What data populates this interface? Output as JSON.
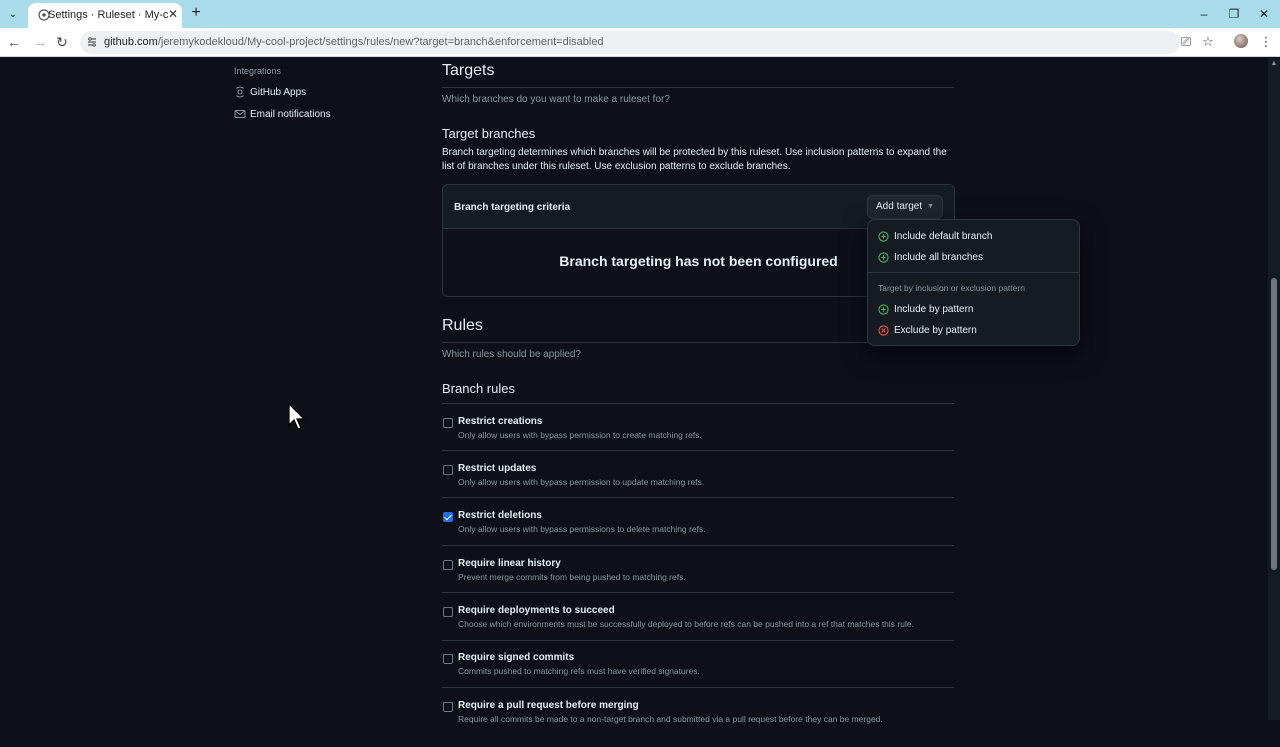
{
  "browser": {
    "tab_title": "Settings · Ruleset · My-cool-pro",
    "url_host": "github.com",
    "url_path": "/jeremykodekloud/My-cool-project/settings/rules/new?target=branch&enforcement=disabled"
  },
  "sidebar": {
    "heading": "Integrations",
    "items": [
      {
        "label": "GitHub Apps",
        "icon": "apps-icon"
      },
      {
        "label": "Email notifications",
        "icon": "mail-icon"
      }
    ]
  },
  "targets": {
    "title": "Targets",
    "subtitle": "Which branches do you want to make a ruleset for?",
    "branches_title": "Target branches",
    "branches_desc": "Branch targeting determines which branches will be protected by this ruleset. Use inclusion patterns to expand the list of branches under this ruleset. Use exclusion patterns to exclude branches.",
    "criteria_label": "Branch targeting criteria",
    "add_target_label": "Add target",
    "empty_message": "Branch targeting has not been configured"
  },
  "dropdown": {
    "items": [
      {
        "label": "Include default branch",
        "icon": "plus-circle-icon"
      },
      {
        "label": "Include all branches",
        "icon": "plus-circle-icon"
      }
    ],
    "group_label": "Target by inclusion or exclusion pattern",
    "pattern_items": [
      {
        "label": "Include by pattern",
        "icon": "plus-circle-icon"
      },
      {
        "label": "Exclude by pattern",
        "icon": "x-circle-icon"
      }
    ]
  },
  "rules": {
    "title": "Rules",
    "subtitle": "Which rules should be applied?",
    "branch_rules_title": "Branch rules",
    "items": [
      {
        "title": "Restrict creations",
        "desc": "Only allow users with bypass permission to create matching refs.",
        "checked": false
      },
      {
        "title": "Restrict updates",
        "desc": "Only allow users with bypass permission to update matching refs.",
        "checked": false
      },
      {
        "title": "Restrict deletions",
        "desc": "Only allow users with bypass permissions to delete matching refs.",
        "checked": true
      },
      {
        "title": "Require linear history",
        "desc": "Prevent merge commits from being pushed to matching refs.",
        "checked": false
      },
      {
        "title": "Require deployments to succeed",
        "desc": "Choose which environments must be successfully deployed to before refs can be pushed into a ref that matches this rule.",
        "checked": false
      },
      {
        "title": "Require signed commits",
        "desc": "Commits pushed to matching refs must have verified signatures.",
        "checked": false
      },
      {
        "title": "Require a pull request before merging",
        "desc": "Require all commits be made to a non-target branch and submitted via a pull request before they can be merged.",
        "checked": false
      }
    ]
  },
  "colors": {
    "accent": "#1f6feb",
    "success": "#3fb950",
    "danger": "#f85149",
    "background": "#0d1117"
  }
}
